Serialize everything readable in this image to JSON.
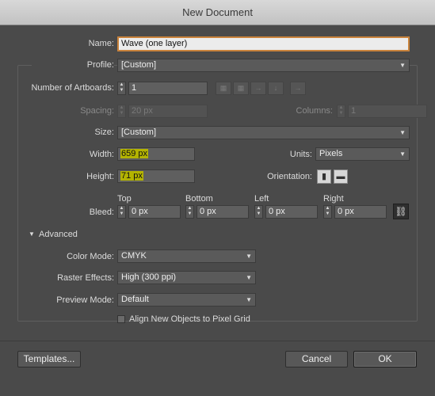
{
  "window": {
    "title": "New Document"
  },
  "name": {
    "label": "Name:",
    "value": "Wave (one layer)"
  },
  "profile": {
    "label": "Profile:",
    "value": "[Custom]"
  },
  "artboards": {
    "label": "Number of Artboards:",
    "value": "1"
  },
  "spacing": {
    "label": "Spacing:",
    "value": "20 px"
  },
  "columns": {
    "label": "Columns:",
    "value": "1"
  },
  "size": {
    "label": "Size:",
    "value": "[Custom]"
  },
  "width": {
    "label": "Width:",
    "value": "659 px"
  },
  "units": {
    "label": "Units:",
    "value": "Pixels"
  },
  "height": {
    "label": "Height:",
    "value": "71 px"
  },
  "orientation": {
    "label": "Orientation:"
  },
  "bleed": {
    "label": "Bleed:",
    "top_label": "Top",
    "top_value": "0 px",
    "bottom_label": "Bottom",
    "bottom_value": "0 px",
    "left_label": "Left",
    "left_value": "0 px",
    "right_label": "Right",
    "right_value": "0 px"
  },
  "advanced": {
    "label": "Advanced",
    "color_mode_label": "Color Mode:",
    "color_mode_value": "CMYK",
    "raster_label": "Raster Effects:",
    "raster_value": "High (300 ppi)",
    "preview_label": "Preview Mode:",
    "preview_value": "Default",
    "align_label": "Align New Objects to Pixel Grid"
  },
  "footer": {
    "templates": "Templates...",
    "cancel": "Cancel",
    "ok": "OK"
  },
  "icons": {
    "spin_up": "▲",
    "spin_down": "▼",
    "dropdown": "▼",
    "disclosure": "▼",
    "portrait": "portrait-orientation-icon",
    "landscape": "landscape-orientation-icon",
    "link": "link-icon"
  },
  "colors": {
    "dialog_bg": "#4a4a4a",
    "highlight": "#b3b300",
    "focus_ring": "#c9833c"
  }
}
